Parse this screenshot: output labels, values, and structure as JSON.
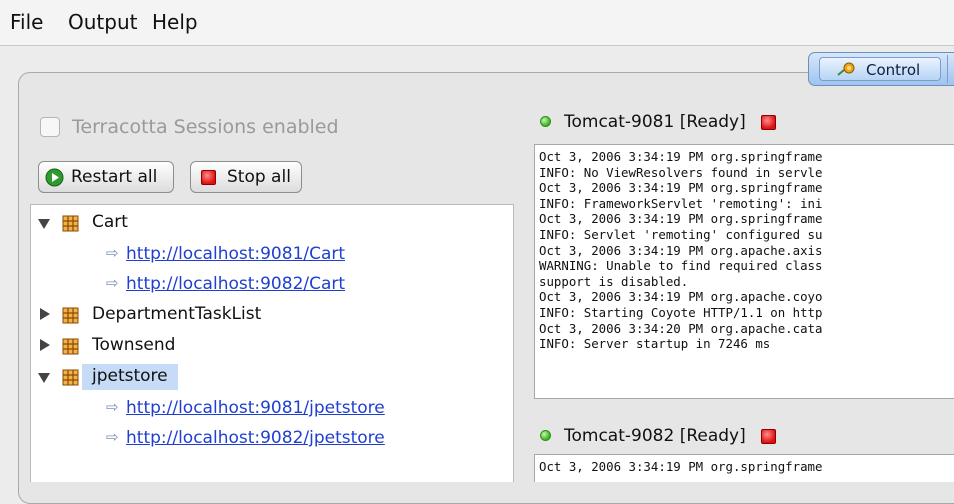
{
  "menu": [
    "File",
    "Output",
    "Help"
  ],
  "tab": {
    "active_label": "Control"
  },
  "left_panel": {
    "checkbox_label": "Terracotta Sessions enabled",
    "restart_label": "Restart all",
    "stop_label": "Stop all"
  },
  "tree": {
    "cart": {
      "label": "Cart",
      "links": [
        "http://localhost:9081/Cart",
        "http://localhost:9082/Cart"
      ]
    },
    "departmenttasklist": {
      "label": "DepartmentTaskList"
    },
    "townsend": {
      "label": "Townsend"
    },
    "jpetstore": {
      "label": "jpetstore",
      "links": [
        "http://localhost:9081/jpetstore",
        "http://localhost:9082/jpetstore"
      ]
    }
  },
  "servers": [
    {
      "title": "Tomcat-9081 [Ready]",
      "log": [
        "Oct 3, 2006 3:34:19 PM org.springframe",
        "INFO: No ViewResolvers found in servle",
        "Oct 3, 2006 3:34:19 PM org.springframe",
        "INFO: FrameworkServlet 'remoting': ini",
        "Oct 3, 2006 3:34:19 PM org.springframe",
        "INFO: Servlet 'remoting' configured su",
        "Oct 3, 2006 3:34:19 PM org.apache.axis",
        "WARNING: Unable to find required class",
        "support is disabled.",
        "Oct 3, 2006 3:34:19 PM org.apache.coyo",
        "INFO: Starting Coyote HTTP/1.1 on http",
        "Oct 3, 2006 3:34:20 PM org.apache.cata",
        "INFO: Server startup in 7246 ms"
      ]
    },
    {
      "title": "Tomcat-9082 [Ready]",
      "log": [
        "Oct 3, 2006 3:34:19 PM org.springframe"
      ]
    }
  ],
  "colors": {
    "link": "#1f3fd0",
    "selection": "#c5dbf6",
    "ready_dot": "#37b21b",
    "stop": "#dd1111",
    "tab_accent": "#9fc4ef"
  },
  "icons": [
    "play-circle-icon",
    "stop-square-icon",
    "web-app-icon",
    "link-arrow-icon",
    "control-icon"
  ]
}
